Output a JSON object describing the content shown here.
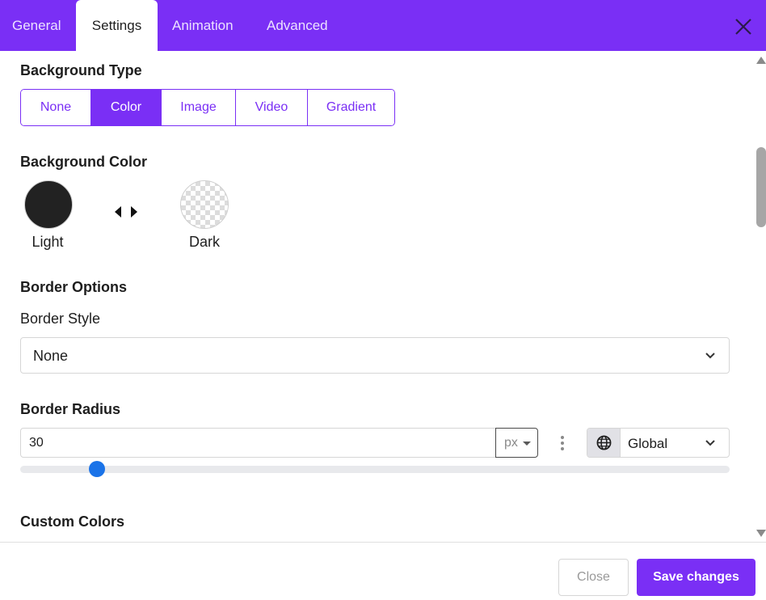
{
  "tabs": [
    {
      "label": "General"
    },
    {
      "label": "Settings",
      "active": true
    },
    {
      "label": "Animation"
    },
    {
      "label": "Advanced"
    }
  ],
  "background_type": {
    "title": "Background Type",
    "options": [
      "None",
      "Color",
      "Image",
      "Video",
      "Gradient"
    ],
    "selected": "Color"
  },
  "background_color": {
    "title": "Background Color",
    "light_label": "Light",
    "dark_label": "Dark",
    "light_color": "#222222"
  },
  "border_options": {
    "title": "Border Options",
    "style_label": "Border Style",
    "style_value": "None"
  },
  "border_radius": {
    "title": "Border Radius",
    "value": "30",
    "unit": "px",
    "scope": "Global",
    "slider_fraction": 0.108
  },
  "custom_colors": {
    "title": "Custom Colors"
  },
  "footer": {
    "close_label": "Close",
    "save_label": "Save changes"
  },
  "colors": {
    "accent": "#7a2ff5",
    "slider": "#1a73e8"
  }
}
